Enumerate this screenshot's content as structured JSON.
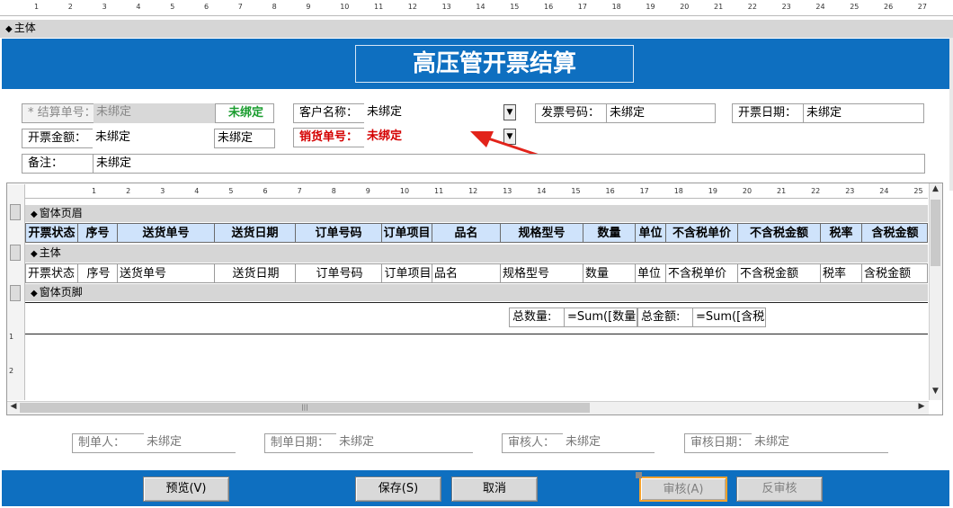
{
  "ruler_ticks": [
    "1",
    "2",
    "3",
    "4",
    "5",
    "6",
    "7",
    "8",
    "9",
    "10",
    "11",
    "12",
    "13",
    "14",
    "15",
    "16",
    "17",
    "18",
    "19",
    "20",
    "21",
    "22",
    "23",
    "24",
    "25",
    "26",
    "27"
  ],
  "section_main": "主体",
  "form_title": "高压管开票结算",
  "fields": {
    "settle_no_label": "* 结算单号：",
    "settle_no_value": "未绑定",
    "settle_no_status": "未绑定",
    "customer_label": "客户名称：",
    "customer_value": "未绑定",
    "invoice_no_label": "发票号码：",
    "invoice_no_value": "未绑定",
    "invoice_date_label": "开票日期：",
    "invoice_date_value": "未绑定",
    "amount_label": "开票金额：",
    "amount_value": "未绑定",
    "amount_value2": "未绑定",
    "sales_no_label": "销货单号：",
    "sales_no_value": "未绑定",
    "remark_label": "备注：",
    "remark_value": "未绑定"
  },
  "subform": {
    "header_section": "窗体页眉",
    "detail_section": "主体",
    "footer_section": "窗体页脚",
    "columns": [
      "开票状态",
      "序号",
      "送货单号",
      "送货日期",
      "订单号码",
      "订单项目",
      "品名",
      "规格型号",
      "数量",
      "单位",
      "不含税单价",
      "不含税金额",
      "税率",
      "含税金额"
    ],
    "row": [
      "开票状态",
      "序号",
      "送货单号",
      "送货日期",
      "订单号码",
      "订单项目",
      "品名",
      "规格型号",
      "数量",
      "单位",
      "不含税单价",
      "不含税金额",
      "税率",
      "含税金额"
    ],
    "total_qty_label": "总数量:",
    "total_qty_expr": "=Sum([数量])",
    "total_amt_label": "总金额:",
    "total_amt_expr": "=Sum([含税金额])",
    "vruler": [
      "1",
      "2"
    ],
    "hscroll_grip": "|||"
  },
  "audit": {
    "creator_label": "制单人：",
    "creator_value": "未绑定",
    "create_date_label": "制单日期：",
    "create_date_value": "未绑定",
    "reviewer_label": "审核人：",
    "reviewer_value": "未绑定",
    "review_date_label": "审核日期：",
    "review_date_value": "未绑定"
  },
  "buttons": {
    "preview": "预览(V)",
    "save": "保存(S)",
    "cancel": "取消",
    "approve": "审核(A)",
    "unapprove": "反审核"
  },
  "colors": {
    "banner_blue": "#0e6fc0",
    "header_cell_bg": "#cfe3fb",
    "bound_green": "#1a9c2e",
    "alert_red": "#d40000",
    "selection_orange": "#f4a22d"
  }
}
